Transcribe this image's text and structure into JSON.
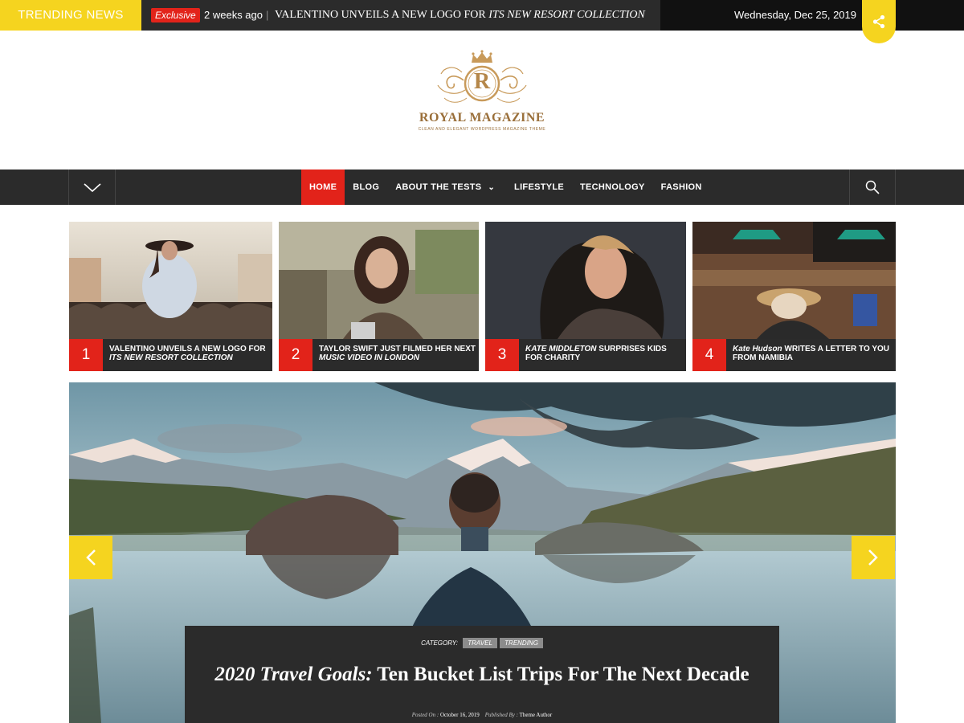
{
  "topbar": {
    "trending_label": "TRENDING NEWS",
    "ticker": {
      "badge": "Exclusive",
      "time_ago": "2 weeks ago",
      "separator": "|",
      "headline_main": "VALENTINO UNVEILS A NEW LOGO FOR ",
      "headline_italic": "ITS NEW RESORT COLLECTION"
    },
    "date": "Wednesday, Dec 25, 2019",
    "share_icon": "share-icon"
  },
  "logo": {
    "letter": "R",
    "title": "ROYAL MAGAZINE",
    "tagline": "CLEAN AND ELEGANT WORDPRESS MAGAZINE THEME"
  },
  "nav": {
    "items": [
      {
        "label": "HOME",
        "active": true
      },
      {
        "label": "BLOG"
      },
      {
        "label": "ABOUT THE TESTS",
        "has_dropdown": true
      },
      {
        "label": "LIFESTYLE"
      },
      {
        "label": "TECHNOLOGY"
      },
      {
        "label": "FASHION"
      }
    ],
    "dropdown_chevron": "⌄",
    "search_icon": "search-icon",
    "menu_toggle_icon": "chevron-down-icon"
  },
  "featured": [
    {
      "num": "1",
      "title": "VALENTINO UNVEILS A NEW LOGO FOR ",
      "title_italic": "ITS NEW RESORT COLLECTION"
    },
    {
      "num": "2",
      "title": "TAYLOR SWIFT JUST FILMED HER NEXT ",
      "title_italic": "MUSIC VIDEO IN LONDON"
    },
    {
      "num": "3",
      "title_italic_first": "KATE MIDDLETON",
      "title": " SURPRISES KIDS FOR CHARITY"
    },
    {
      "num": "4",
      "title_italic_first": "Kate Hudson",
      "title": " WRITES A LETTER TO YOU FROM NAMIBIA"
    }
  ],
  "slider": {
    "category_label": "CATEGORY:",
    "categories": [
      "TRAVEL",
      "TRENDING"
    ],
    "title_italic": "2020 Travel Goals:",
    "title_rest": " Ten Bucket List Trips For The Next Decade",
    "posted_label": "Posted On :",
    "posted_date": "October 16, 2019",
    "author_label": "Published By :",
    "author": "Theme Author",
    "prev_icon": "chevron-left-icon",
    "next_icon": "chevron-right-icon"
  },
  "colors": {
    "accent_yellow": "#f5d41f",
    "accent_red": "#e2231a",
    "dark": "#2b2b2b",
    "gold": "#9a6f3a"
  }
}
